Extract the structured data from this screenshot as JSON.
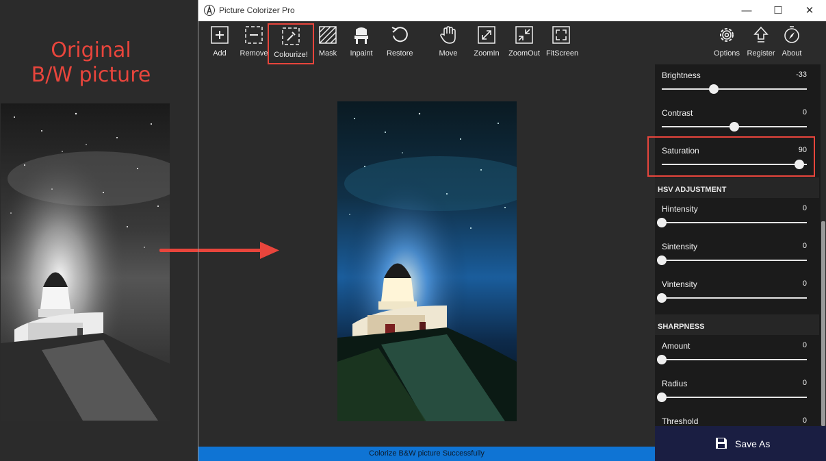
{
  "annotation": {
    "line1": "Original",
    "line2": "B/W picture",
    "accent": "#e8453c"
  },
  "window": {
    "title": "Picture Colorizer Pro",
    "controls": {
      "minimize": "—",
      "maximize": "☐",
      "close": "✕"
    }
  },
  "toolbar": {
    "items": [
      {
        "label": "Add",
        "icon": "plus-box-icon"
      },
      {
        "label": "Remove",
        "icon": "minus-box-icon"
      },
      {
        "label": "Colourize!",
        "icon": "eyedropper-icon"
      },
      {
        "label": "Mask",
        "icon": "mask-hatch-icon"
      },
      {
        "label": "Inpaint",
        "icon": "chair-icon"
      },
      {
        "label": "Restore",
        "icon": "restore-icon"
      },
      {
        "label": "Move",
        "icon": "hand-icon"
      },
      {
        "label": "ZoomIn",
        "icon": "zoom-in-icon"
      },
      {
        "label": "ZoomOut",
        "icon": "zoom-out-icon"
      },
      {
        "label": "FitScreen",
        "icon": "fit-screen-icon"
      },
      {
        "label": "Options",
        "icon": "gear-icon"
      },
      {
        "label": "Register",
        "icon": "upload-arrow-icon"
      },
      {
        "label": "About",
        "icon": "compass-icon"
      }
    ]
  },
  "adjust": {
    "brightness": {
      "label": "Brightness",
      "value": "-33",
      "fraction": 0.36
    },
    "contrast": {
      "label": "Contrast",
      "value": "0",
      "fraction": 0.5
    },
    "saturation": {
      "label": "Saturation",
      "value": "90",
      "fraction": 0.95
    },
    "hsv_title": "HSV ADJUSTMENT",
    "hintensity": {
      "label": "Hintensity",
      "value": "0",
      "fraction": 0.0
    },
    "sintensity": {
      "label": "Sintensity",
      "value": "0",
      "fraction": 0.0
    },
    "vintensity": {
      "label": "Vintensity",
      "value": "0",
      "fraction": 0.0
    },
    "sharpness_title": "SHARPNESS",
    "amount": {
      "label": "Amount",
      "value": "0",
      "fraction": 0.0
    },
    "radius": {
      "label": "Radius",
      "value": "0",
      "fraction": 0.0
    },
    "threshold": {
      "label": "Threshold",
      "value": "0",
      "fraction": 0.0
    }
  },
  "save_label": "Save As",
  "status": "Colorize B&W picture Successfully",
  "colors": {
    "status_bar": "#0f74d4",
    "save_bg": "#1a1e42",
    "highlight": "#e8453c"
  }
}
